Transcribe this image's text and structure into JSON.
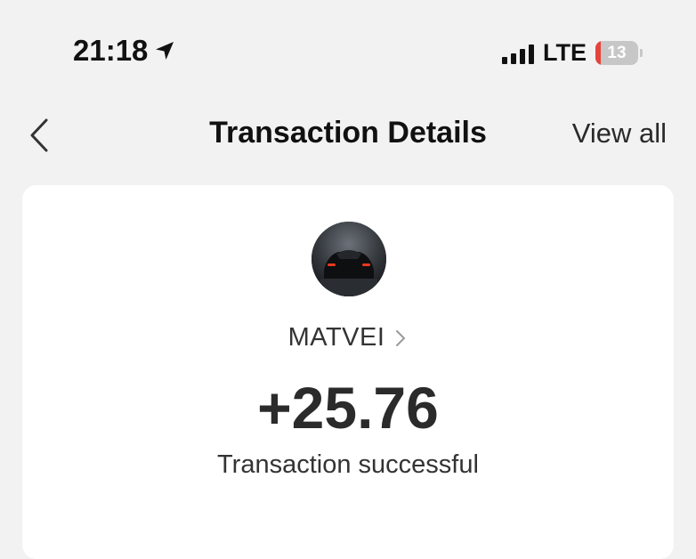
{
  "status_bar": {
    "time": "21:18",
    "network": "LTE",
    "battery_level": "13",
    "battery_fraction": 0.13,
    "battery_color": "#e5433b"
  },
  "nav": {
    "title": "Transaction Details",
    "view_all_label": "View all"
  },
  "transaction": {
    "counterparty": "MATVEI",
    "amount": "+25.76",
    "status": "Transaction successful"
  }
}
